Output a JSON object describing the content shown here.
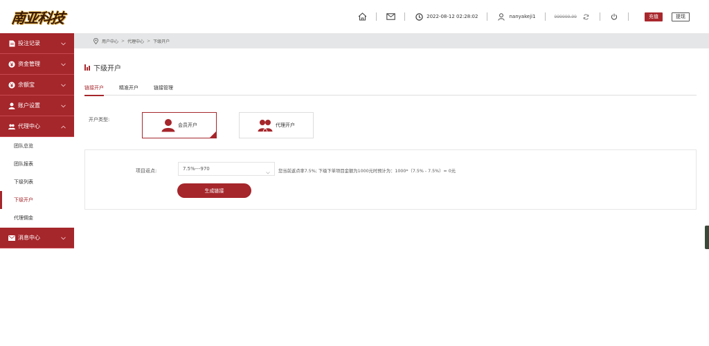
{
  "header": {
    "logo_text": "南亚科技",
    "datetime": "2022-08-12 02:28:02",
    "username": "nanyakeji1",
    "balance": "999999.99",
    "recharge_label": "充值",
    "withdraw_label": "提现",
    "icons": [
      "home-icon",
      "mail-icon",
      "clock-icon",
      "user-icon",
      "refresh-icon",
      "power-icon"
    ]
  },
  "sidebar": {
    "groups": [
      {
        "label": "投注记录",
        "icon": "document-icon"
      },
      {
        "label": "资金管理",
        "icon": "yen-coin-icon"
      },
      {
        "label": "余额宝",
        "icon": "yen-coin-icon"
      },
      {
        "label": "账户设置",
        "icon": "user-icon"
      },
      {
        "label": "代理中心",
        "icon": "users-icon"
      }
    ],
    "agent_subitems": [
      "团队总览",
      "团队报表",
      "下级列表",
      "下级开户",
      "代理佣金"
    ],
    "active_subitem": "下级开户",
    "message_center": "消息中心"
  },
  "breadcrumb": {
    "items": [
      "用户中心",
      "代理中心",
      "下级开户"
    ],
    "separator": ">"
  },
  "page": {
    "title": "下级开户",
    "tabs": [
      "链接开户",
      "精准开户",
      "链接管理"
    ],
    "active_tab": "链接开户",
    "account_type_label": "开户类型:",
    "account_types": [
      "会员开户",
      "代理开户"
    ],
    "selected_account_type": "会员开户",
    "rebate_label": "项目返点:",
    "rebate_value": "7.5%---970",
    "rebate_hint": "您当前返点率7.5%;  下级下单项目金额为1000元时预计为：1000*（7.5% - 7.5%）= 0元",
    "generate_button": "生成链接"
  },
  "colors": {
    "accent": "#a5262b",
    "breadcrumb_bg": "#e5e6e7"
  }
}
